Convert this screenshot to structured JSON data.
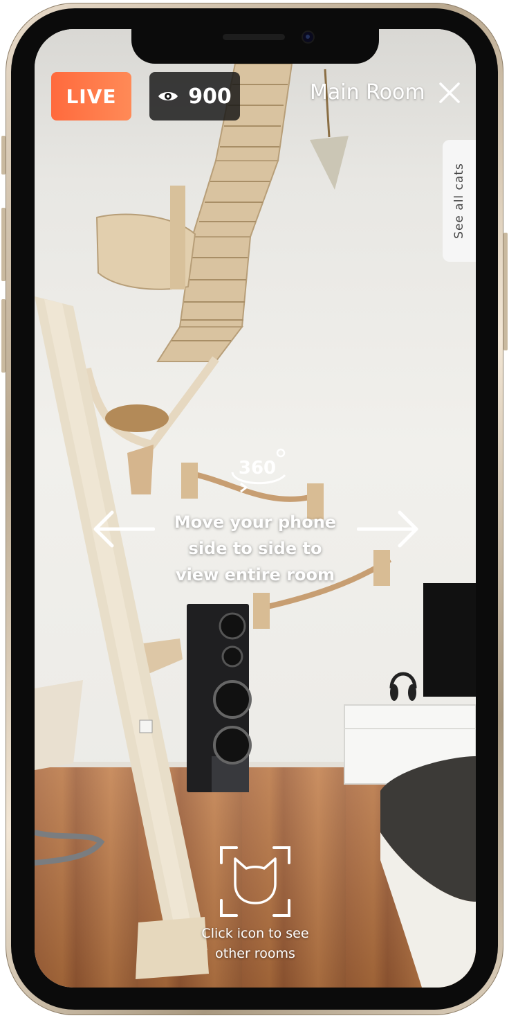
{
  "live": {
    "label": "LIVE"
  },
  "viewers": {
    "icon": "eye-icon",
    "count": "900"
  },
  "room": {
    "title": "Main Room"
  },
  "close": {
    "icon": "close-icon"
  },
  "side_tab": {
    "label": "See all cats"
  },
  "view_hint": {
    "icon": "360-rotate-icon",
    "badge": "360",
    "line1": "Move your phone",
    "line2": "side to side to",
    "line3": "view entire room",
    "left_icon": "arrow-left-icon",
    "right_icon": "arrow-right-icon"
  },
  "room_switch": {
    "icon": "cat-face-icon",
    "caption_line1": "Click icon to see",
    "caption_line2": "other rooms"
  },
  "colors": {
    "live_start": "#ff6a3d",
    "live_end": "#ff8a57",
    "badge_bg": "#141414"
  }
}
